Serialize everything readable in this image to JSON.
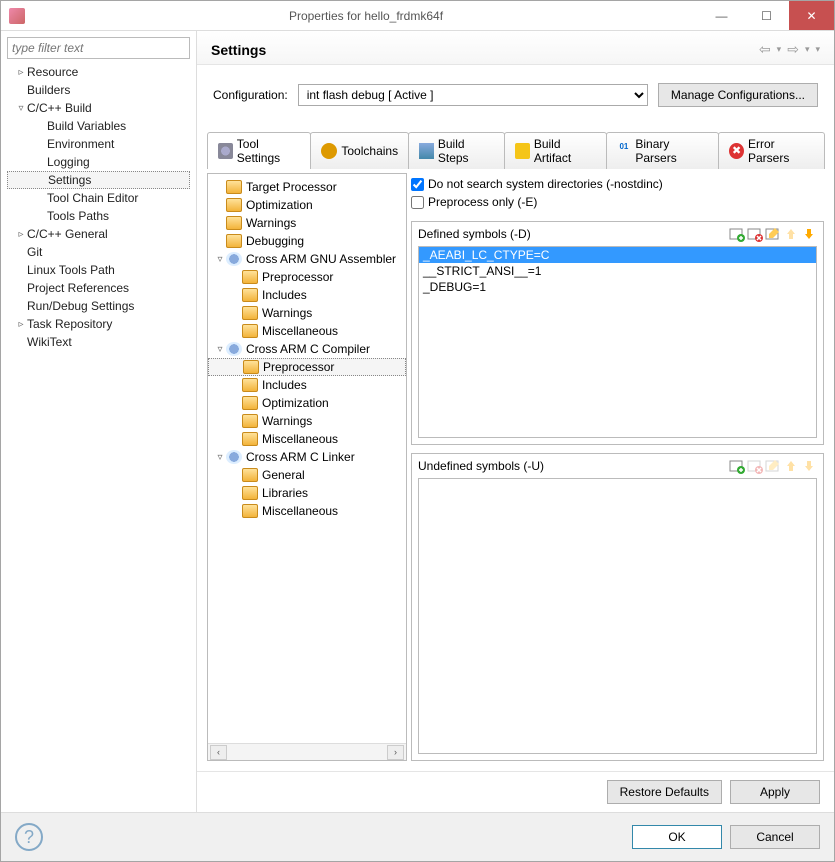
{
  "title": "Properties for hello_frdmk64f",
  "filter_placeholder": "type filter text",
  "left_tree": [
    {
      "label": "Resource",
      "indent": 0,
      "arrow": "▹"
    },
    {
      "label": "Builders",
      "indent": 0,
      "arrow": ""
    },
    {
      "label": "C/C++ Build",
      "indent": 0,
      "arrow": "▿"
    },
    {
      "label": "Build Variables",
      "indent": 1,
      "arrow": ""
    },
    {
      "label": "Environment",
      "indent": 1,
      "arrow": ""
    },
    {
      "label": "Logging",
      "indent": 1,
      "arrow": ""
    },
    {
      "label": "Settings",
      "indent": 1,
      "arrow": "",
      "selected": true
    },
    {
      "label": "Tool Chain Editor",
      "indent": 1,
      "arrow": ""
    },
    {
      "label": "Tools Paths",
      "indent": 1,
      "arrow": ""
    },
    {
      "label": "C/C++ General",
      "indent": 0,
      "arrow": "▹"
    },
    {
      "label": "Git",
      "indent": 0,
      "arrow": ""
    },
    {
      "label": "Linux Tools Path",
      "indent": 0,
      "arrow": ""
    },
    {
      "label": "Project References",
      "indent": 0,
      "arrow": ""
    },
    {
      "label": "Run/Debug Settings",
      "indent": 0,
      "arrow": ""
    },
    {
      "label": "Task Repository",
      "indent": 0,
      "arrow": "▹"
    },
    {
      "label": "WikiText",
      "indent": 0,
      "arrow": ""
    }
  ],
  "page_heading": "Settings",
  "config_label": "Configuration:",
  "config_value": "int flash debug  [ Active ]",
  "manage_btn": "Manage Configurations...",
  "tabs": [
    {
      "label": "Tool Settings",
      "icon": "wrench",
      "active": true
    },
    {
      "label": "Toolchains",
      "icon": "chain"
    },
    {
      "label": "Build Steps",
      "icon": "steps"
    },
    {
      "label": "Build Artifact",
      "icon": "art"
    },
    {
      "label": "Binary Parsers",
      "icon": "bin"
    },
    {
      "label": "Error Parsers",
      "icon": "err"
    }
  ],
  "mid_tree": [
    {
      "label": "Target Processor",
      "indent": 0,
      "icon": "fld",
      "arrow": ""
    },
    {
      "label": "Optimization",
      "indent": 0,
      "icon": "fld",
      "arrow": ""
    },
    {
      "label": "Warnings",
      "indent": 0,
      "icon": "fld",
      "arrow": ""
    },
    {
      "label": "Debugging",
      "indent": 0,
      "icon": "fld",
      "arrow": ""
    },
    {
      "label": "Cross ARM GNU Assembler",
      "indent": 0,
      "icon": "gear",
      "arrow": "▿"
    },
    {
      "label": "Preprocessor",
      "indent": 1,
      "icon": "fld",
      "arrow": ""
    },
    {
      "label": "Includes",
      "indent": 1,
      "icon": "fld",
      "arrow": ""
    },
    {
      "label": "Warnings",
      "indent": 1,
      "icon": "fld",
      "arrow": ""
    },
    {
      "label": "Miscellaneous",
      "indent": 1,
      "icon": "fld",
      "arrow": ""
    },
    {
      "label": "Cross ARM C Compiler",
      "indent": 0,
      "icon": "gear",
      "arrow": "▿"
    },
    {
      "label": "Preprocessor",
      "indent": 1,
      "icon": "fld",
      "arrow": "",
      "selected": true
    },
    {
      "label": "Includes",
      "indent": 1,
      "icon": "fld",
      "arrow": ""
    },
    {
      "label": "Optimization",
      "indent": 1,
      "icon": "fld",
      "arrow": ""
    },
    {
      "label": "Warnings",
      "indent": 1,
      "icon": "fld",
      "arrow": ""
    },
    {
      "label": "Miscellaneous",
      "indent": 1,
      "icon": "fld",
      "arrow": ""
    },
    {
      "label": "Cross ARM C Linker",
      "indent": 0,
      "icon": "gear",
      "arrow": "▿"
    },
    {
      "label": "General",
      "indent": 1,
      "icon": "fld",
      "arrow": ""
    },
    {
      "label": "Libraries",
      "indent": 1,
      "icon": "fld",
      "arrow": ""
    },
    {
      "label": "Miscellaneous",
      "indent": 1,
      "icon": "fld",
      "arrow": ""
    }
  ],
  "check1": "Do not search system directories (-nostdinc)",
  "check1_checked": true,
  "check2": "Preprocess only (-E)",
  "check2_checked": false,
  "defined_label": "Defined symbols (-D)",
  "defined_list": [
    {
      "text": "_AEABI_LC_CTYPE=C",
      "selected": true
    },
    {
      "text": "__STRICT_ANSI__=1"
    },
    {
      "text": "_DEBUG=1"
    }
  ],
  "undefined_label": "Undefined symbols (-U)",
  "undefined_list": [],
  "restore_btn": "Restore Defaults",
  "apply_btn": "Apply",
  "ok_btn": "OK",
  "cancel_btn": "Cancel"
}
